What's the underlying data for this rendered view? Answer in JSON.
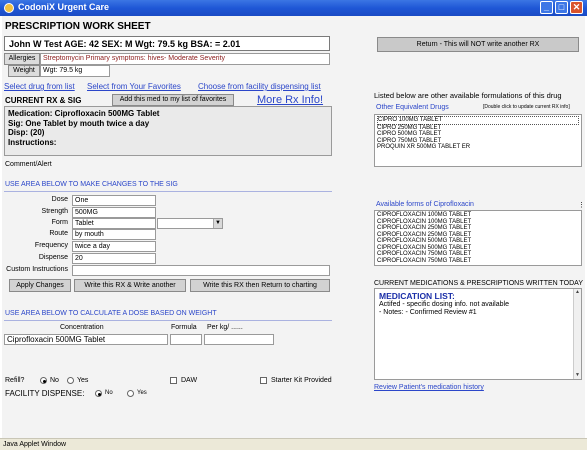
{
  "window": {
    "title": "CodoniX Urgent Care",
    "status": "Java Applet Window"
  },
  "worksheet_title": "PRESCRIPTION WORK SHEET",
  "patient": {
    "summary": "John W Test    AGE: 42  SEX: M      Wgt: 79.5 kg    BSA:  = 2.01"
  },
  "return_button": "Return - This will NOT write another RX",
  "allergies": {
    "label": "Allergies",
    "value": "Streptomycin  Primary symptoms: hives- Moderate Severity"
  },
  "weight": {
    "label": "Weight",
    "value": "Wgt: 79.5 kg"
  },
  "links": {
    "select_drug": "Select drug from list",
    "select_favorites": "Select from Your Favorites",
    "choose_facility": "Choose from facility dispensing list"
  },
  "current_rx": {
    "label": "CURRENT RX & SIG",
    "fav_button": "Add this med to my list of favorites",
    "more_info": "More Rx Info!",
    "lines": [
      "Medication: Ciprofloxacin 500MG Tablet",
      "Sig: One Tablet by mouth twice a day",
      "Disp:  (20)",
      "Instructions:"
    ]
  },
  "comment_label": "Comment/Alert",
  "sig_section": {
    "heading": "USE AREA BELOW TO MAKE CHANGES TO THE SIG",
    "fields": {
      "dose": {
        "label": "Dose",
        "value": "One"
      },
      "strength": {
        "label": "Strength",
        "value": "500MG"
      },
      "form": {
        "label": "Form",
        "value": "Tablet"
      },
      "route": {
        "label": "Route",
        "value": "by mouth"
      },
      "frequency": {
        "label": "Frequency",
        "value": "twice a day"
      },
      "dispense": {
        "label": "Dispense",
        "value": "20"
      },
      "custom": {
        "label": "Custom Instructions",
        "value": ""
      }
    },
    "buttons": {
      "apply": "Apply Changes",
      "write_another": "Write this RX & Write another",
      "write_return": "Write this RX then Return to charting"
    }
  },
  "calc_section": {
    "heading": "USE AREA BELOW TO CALCULATE A DOSE BASED ON WEIGHT",
    "col_concentration": "Concentration",
    "col_formula": "Formula",
    "col_perkg": "Per kg/ ......",
    "concentration_value": "Ciprofloxacin 500MG Tablet"
  },
  "refill": {
    "label": "Refill?",
    "no": "No",
    "yes": "Yes",
    "selected": "No"
  },
  "daw_label": "DAW",
  "starter_kit_label": "Starter Kit Provided",
  "facility": {
    "label": "FACILITY DISPENSE:",
    "no": "No",
    "yes": "Yes",
    "selected": "No"
  },
  "right_panel": {
    "intro": "Listed below are other available formulations of this drug",
    "equiv_label": "Other Equivalent Drugs",
    "equiv_hint": "[Double click to update current RX info]",
    "equiv_items": [
      "CIPRO 100MG TABLET",
      "CIPRO 250MG TABLET",
      "CIPRO 500MG TABLET",
      "CIPRO 750MG TABLET",
      "PROQUIN XR 500MG TABLET ER"
    ],
    "forms_label": "Available forms of Ciprofloxacin",
    "forms_items": [
      "CIPROFLOXACIN 100MG TABLET",
      "CIPROFLOXACIN 100MG TABLET",
      "CIPROFLOXACIN 250MG TABLET",
      "CIPROFLOXACIN 250MG TABLET",
      "CIPROFLOXACIN 500MG TABLET",
      "CIPROFLOXACIN 500MG TABLET",
      "CIPROFLOXACIN 750MG TABLET",
      "CIPROFLOXACIN 750MG TABLET"
    ],
    "current_meds_label": "CURRENT MEDICATIONS & PRESCRIPTIONS WRITTEN TODAY",
    "med_list_heading": "MEDICATION LIST:",
    "med_list_lines": [
      "Actifed   - specific dosing info. not available",
      "-    Notes:  - Confirmed Review #1"
    ],
    "review_link": "Review Patient's medication history"
  },
  "colors": {
    "link": "#2b46c9",
    "titlebar": "#1f57d6",
    "section": "#2b46c9"
  }
}
